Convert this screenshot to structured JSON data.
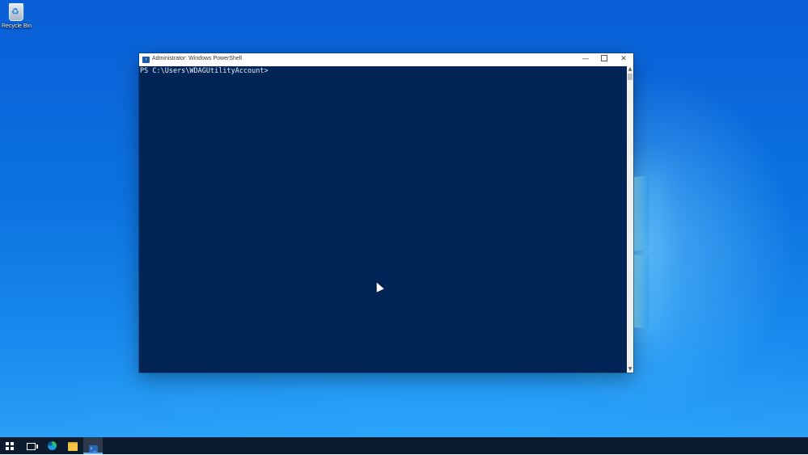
{
  "desktop": {
    "icons": [
      {
        "label": "Recycle Bin",
        "icon": "recycle-bin-icon"
      }
    ]
  },
  "window": {
    "title": "Administrator: Windows PowerShell",
    "app_icon": "powershell-icon",
    "icon_glyph": "›",
    "controls": {
      "minimize": "—",
      "close": "✕"
    }
  },
  "console": {
    "prompt": "PS C:\\Users\\WDAGUtilityAccount>",
    "background": "#012456",
    "foreground": "#e8eef6"
  },
  "scrollbar": {
    "up_arrow": "▲",
    "down_arrow": "▼"
  },
  "taskbar": {
    "items": [
      {
        "name": "start",
        "icon": "windows-start-icon"
      },
      {
        "name": "task-view",
        "icon": "task-view-icon"
      },
      {
        "name": "edge",
        "icon": "edge-browser-icon"
      },
      {
        "name": "file-explorer",
        "icon": "folder-icon"
      },
      {
        "name": "powershell",
        "icon": "powershell-icon",
        "active": true,
        "glyph": "›_"
      }
    ]
  }
}
